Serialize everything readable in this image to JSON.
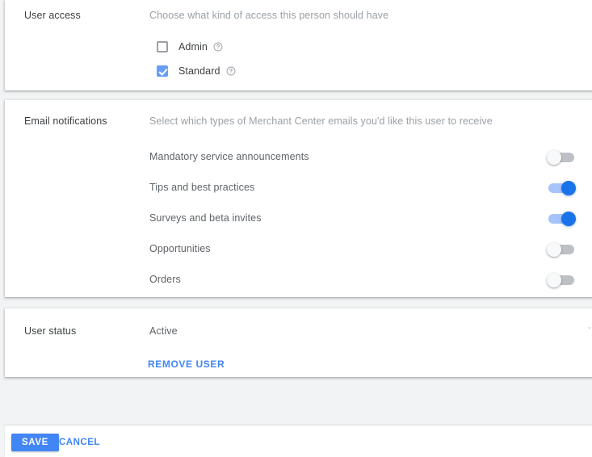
{
  "sections": {
    "user_access": {
      "label": "User access",
      "description": "Choose what kind of access this person should have",
      "options": [
        {
          "label": "Admin",
          "checked": false,
          "help_icon": "help-circle-icon"
        },
        {
          "label": "Standard",
          "checked": true,
          "help_icon": "help-circle-icon"
        }
      ]
    },
    "email_notifications": {
      "label": "Email notifications",
      "description": "Select which types of Merchant Center emails you'd like this user to receive",
      "items": [
        {
          "label": "Mandatory service announcements",
          "enabled": false
        },
        {
          "label": "Tips and best practices",
          "enabled": true
        },
        {
          "label": "Surveys and beta invites",
          "enabled": true
        },
        {
          "label": "Opportunities",
          "enabled": false
        },
        {
          "label": "Orders",
          "enabled": false
        }
      ]
    },
    "user_status": {
      "label": "User status",
      "value": "Active",
      "remove_label": "REMOVE USER",
      "caret_icon": "chevron-down-icon"
    }
  },
  "footer": {
    "save_label": "SAVE",
    "cancel_label": "CANCEL"
  },
  "colors": {
    "accent_blue": "#4285f4",
    "toggle_on": "#1a73e8",
    "toggle_on_track": "#a6c4fb",
    "toggle_off_track": "#bdc1c6",
    "checkbox_checked": "#669df6",
    "page_background": "#f1f3f4",
    "card_background": "#ffffff",
    "label_text": "#3c4043",
    "muted_text": "#9aa0a6",
    "body_text": "#5f6368"
  }
}
